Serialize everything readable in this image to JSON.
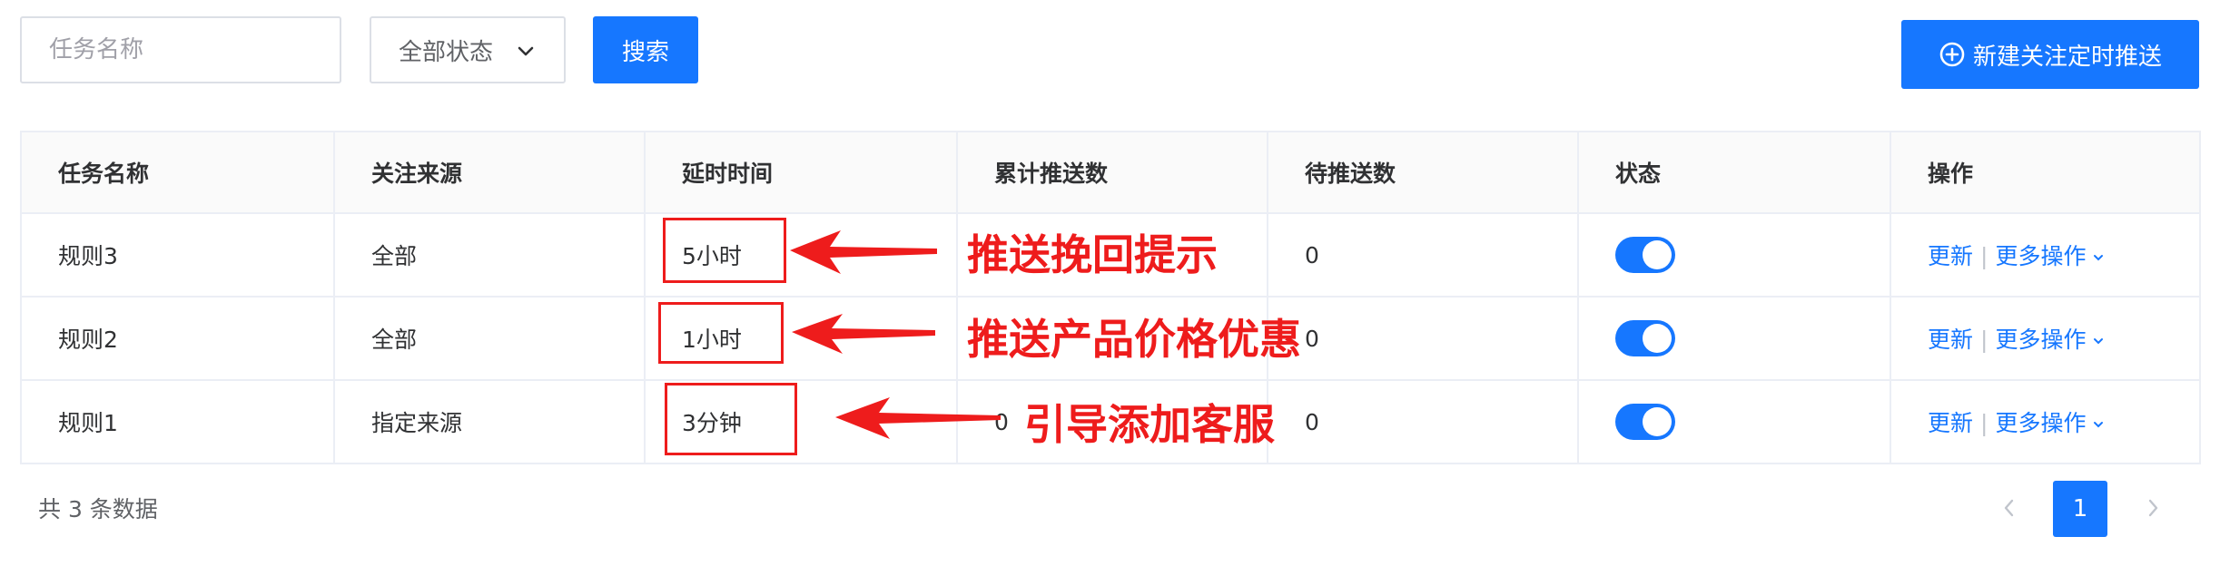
{
  "filters": {
    "task_name_placeholder": "任务名称",
    "status_select_value": "全部状态",
    "search_label": "搜索"
  },
  "toolbar": {
    "new_button_label": "新建关注定时推送"
  },
  "table": {
    "headers": [
      "任务名称",
      "关注来源",
      "延时时间",
      "累计推送数",
      "待推送数",
      "状态",
      "操作"
    ],
    "rows": [
      {
        "name": "规则3",
        "source": "全部",
        "delay": "5小时",
        "total_pushed": "",
        "pending": "0",
        "status_on": true,
        "action_update": "更新",
        "action_more": "更多操作"
      },
      {
        "name": "规则2",
        "source": "全部",
        "delay": "1小时",
        "total_pushed": "",
        "pending": "0",
        "status_on": true,
        "action_update": "更新",
        "action_more": "更多操作"
      },
      {
        "name": "规则1",
        "source": "指定来源",
        "delay": "3分钟",
        "total_pushed": "0",
        "pending": "0",
        "status_on": true,
        "action_update": "更新",
        "action_more": "更多操作"
      }
    ]
  },
  "annotations": [
    "推送挽回提示",
    "推送产品价格优惠",
    "引导添加客服"
  ],
  "footer": {
    "total_text": "共 3 条数据",
    "current_page": "1"
  },
  "colors": {
    "primary": "#1677ff",
    "annotation_red": "#ee1c1c",
    "border": "#ebeef5"
  },
  "icons": [
    "chevron-down-icon",
    "plus-circle-icon",
    "chevron-left-icon",
    "chevron-right-icon"
  ]
}
